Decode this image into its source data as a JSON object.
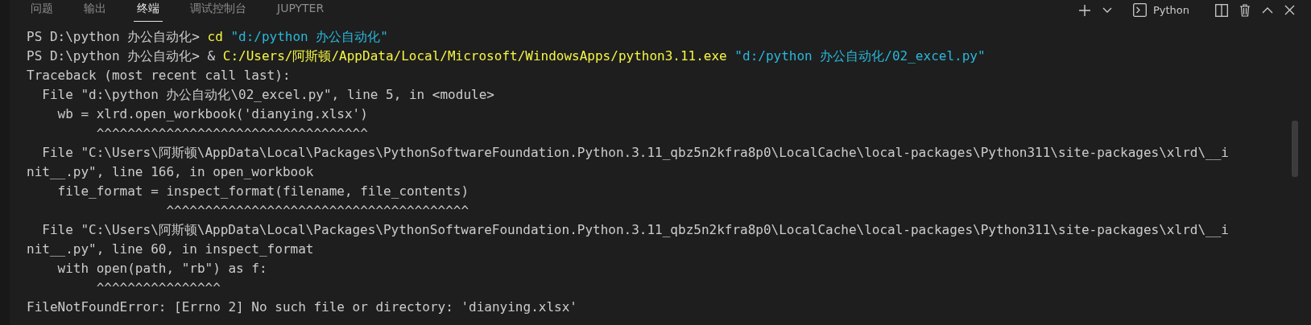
{
  "tabs": [
    {
      "label": "问题",
      "selected": false
    },
    {
      "label": "输出",
      "selected": false
    },
    {
      "label": "终端",
      "selected": true
    },
    {
      "label": "调试控制台",
      "selected": false
    },
    {
      "label": "JUPYTER",
      "selected": false
    }
  ],
  "toolbar": {
    "terminal_name": "Python"
  },
  "terminal_lines": [
    {
      "segments": [
        {
          "text": "PS D:\\python 办公自动化> ",
          "kind": "plain"
        },
        {
          "text": "cd",
          "kind": "command"
        },
        {
          "text": " \"d:/python 办公自动化\"",
          "kind": "string"
        }
      ]
    },
    {
      "segments": [
        {
          "text": "PS D:\\python 办公自动化> & ",
          "kind": "plain"
        },
        {
          "text": "C:/Users/阿斯顿/AppData/Local/Microsoft/WindowsApps/python3.11.exe",
          "kind": "command"
        },
        {
          "text": " \"d:/python 办公自动化/02_excel.py\"",
          "kind": "string"
        }
      ]
    },
    {
      "segments": [
        {
          "text": "Traceback (most recent call last):",
          "kind": "plain"
        }
      ]
    },
    {
      "segments": [
        {
          "text": "  File \"d:\\python 办公自动化\\02_excel.py\", line 5, in <module>",
          "kind": "plain"
        }
      ]
    },
    {
      "segments": [
        {
          "text": "    wb = xlrd.open_workbook('dianying.xlsx')",
          "kind": "plain"
        }
      ]
    },
    {
      "segments": [
        {
          "text": "         ^^^^^^^^^^^^^^^^^^^^^^^^^^^^^^^^^^^",
          "kind": "plain"
        }
      ]
    },
    {
      "segments": [
        {
          "text": "  File \"C:\\Users\\阿斯顿\\AppData\\Local\\Packages\\PythonSoftwareFoundation.Python.3.11_qbz5n2kfra8p0\\LocalCache\\local-packages\\Python311\\site-packages\\xlrd\\__i",
          "kind": "plain"
        }
      ]
    },
    {
      "segments": [
        {
          "text": "nit__.py\", line 166, in open_workbook",
          "kind": "plain"
        }
      ]
    },
    {
      "segments": [
        {
          "text": "    file_format = inspect_format(filename, file_contents)",
          "kind": "plain"
        }
      ]
    },
    {
      "segments": [
        {
          "text": "                  ^^^^^^^^^^^^^^^^^^^^^^^^^^^^^^^^^^^^^^^",
          "kind": "plain"
        }
      ]
    },
    {
      "segments": [
        {
          "text": "  File \"C:\\Users\\阿斯顿\\AppData\\Local\\Packages\\PythonSoftwareFoundation.Python.3.11_qbz5n2kfra8p0\\LocalCache\\local-packages\\Python311\\site-packages\\xlrd\\__i",
          "kind": "plain"
        }
      ]
    },
    {
      "segments": [
        {
          "text": "nit__.py\", line 60, in inspect_format",
          "kind": "plain"
        }
      ]
    },
    {
      "segments": [
        {
          "text": "    with open(path, \"rb\") as f:",
          "kind": "plain"
        }
      ]
    },
    {
      "segments": [
        {
          "text": "         ^^^^^^^^^^^^^^^^",
          "kind": "plain"
        }
      ]
    },
    {
      "segments": [
        {
          "text": "FileNotFoundError: [Errno 2] No such file or directory: 'dianying.xlsx'",
          "kind": "plain"
        }
      ]
    }
  ]
}
